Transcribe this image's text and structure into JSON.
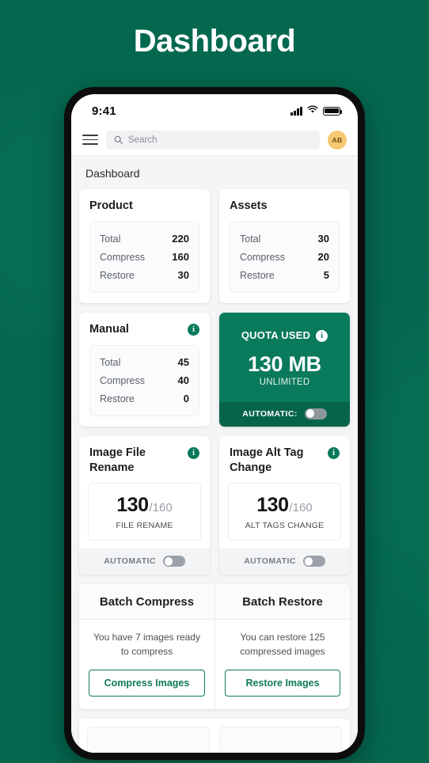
{
  "poster": {
    "title": "Dashboard",
    "background_color": "#04684f"
  },
  "theme": {
    "brand_green": "#0a7a5c",
    "brand_green_dark": "#066549",
    "avatar_bg": "#f7c873",
    "screen_bg": "#f4f5f6"
  },
  "phone": {
    "statusbar": {
      "time": "9:41",
      "signal_icon": "signal-bars-icon",
      "wifi_icon": "wifi-icon",
      "battery_icon": "battery-icon"
    },
    "appbar": {
      "menu_icon": "hamburger-menu-icon",
      "search_icon": "search-icon",
      "search_placeholder": "Search",
      "avatar_initials": "AB"
    },
    "page_heading": "Dashboard",
    "stat_cards": [
      {
        "title": "Product",
        "has_info": false,
        "rows": [
          {
            "label": "Total",
            "value": "220"
          },
          {
            "label": "Compress",
            "value": "160"
          },
          {
            "label": "Restore",
            "value": "30"
          }
        ]
      },
      {
        "title": "Assets",
        "has_info": false,
        "rows": [
          {
            "label": "Total",
            "value": "30"
          },
          {
            "label": "Compress",
            "value": "20"
          },
          {
            "label": "Restore",
            "value": "5"
          }
        ]
      },
      {
        "title": "Manual",
        "has_info": true,
        "info_icon": "info-icon",
        "rows": [
          {
            "label": "Total",
            "value": "45"
          },
          {
            "label": "Compress",
            "value": "40"
          },
          {
            "label": "Restore",
            "value": "0"
          }
        ]
      }
    ],
    "quota_card": {
      "label": "QUOTA USED",
      "info_icon": "info-icon",
      "value": "130 MB",
      "subtitle": "UNLIMITED",
      "toggle_label": "AUTOMATIC:",
      "toggle_state": "off"
    },
    "counter_cards": [
      {
        "title": "Image File Rename",
        "info_icon": "info-icon",
        "number": "130",
        "denominator": "/160",
        "caption": "FILE RENAME",
        "toggle_label": "AUTOMATIC",
        "toggle_state": "off"
      },
      {
        "title": "Image Alt Tag Change",
        "info_icon": "info-icon",
        "number": "130",
        "denominator": "/160",
        "caption": "ALT TAGS CHANGE",
        "toggle_label": "AUTOMATIC",
        "toggle_state": "off"
      }
    ],
    "batch": [
      {
        "title": "Batch Compress",
        "description": "You have 7 images ready to compress",
        "button": "Compress Images"
      },
      {
        "title": "Batch Restore",
        "description": "You can restore 125 compressed images",
        "button": "Restore Images"
      }
    ]
  }
}
